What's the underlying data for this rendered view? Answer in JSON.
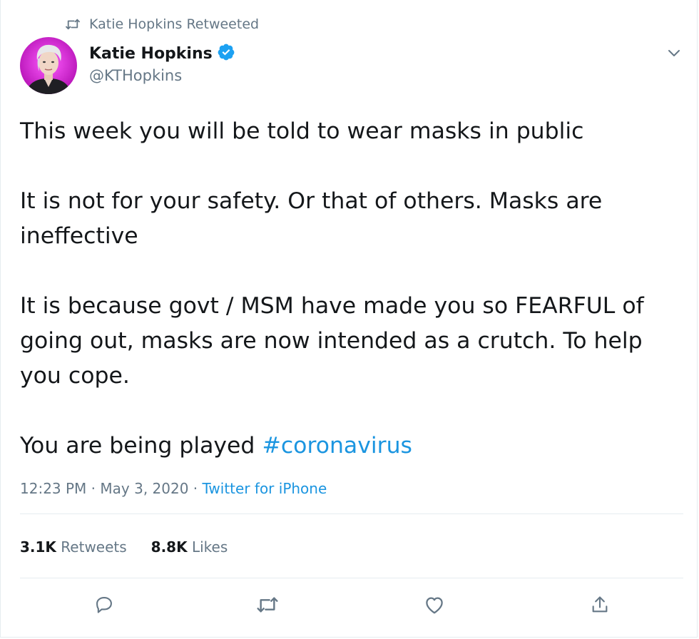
{
  "retweet_header": {
    "label": "Katie Hopkins Retweeted",
    "icon": "retweet-icon"
  },
  "author": {
    "name": "Katie Hopkins",
    "handle": "@KTHopkins",
    "verified": true,
    "verified_color": "#1da1f2",
    "avatar_ring_color": "#d61fd6"
  },
  "tweet": {
    "paragraphs": [
      "This week you will be told to wear masks in public",
      "It is not for your safety. Or that of others. Masks are\nineffective",
      "It is because govt / MSM have made you so FEARFUL of\ngoing out, masks are now intended as a crutch. To help\nyou cope."
    ],
    "last_line_text": "You are being played ",
    "hashtag": "#coronavirus"
  },
  "meta": {
    "time": "12:23 PM",
    "separator": " · ",
    "date": "May 3, 2020",
    "source": "Twitter for iPhone"
  },
  "stats": {
    "retweets_count": "3.1K",
    "retweets_label": " Retweets",
    "likes_count": "8.8K",
    "likes_label": " Likes"
  },
  "actions": {
    "reply_icon": "reply-icon",
    "retweet_icon": "retweet-icon",
    "like_icon": "heart-icon",
    "share_icon": "share-icon"
  },
  "colors": {
    "link": "#1b95e0",
    "secondary_text": "#657786",
    "primary_text": "#14171a",
    "divider": "#e6ecf0"
  }
}
